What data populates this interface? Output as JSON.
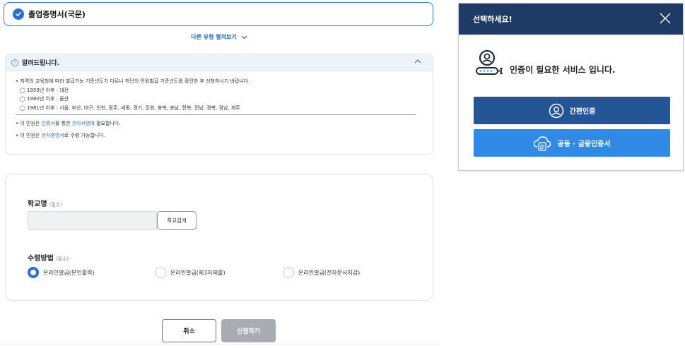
{
  "document": {
    "selected_name": "졸업증명서(국문)",
    "more_types_label": "다른 유형 펼쳐보기"
  },
  "notice": {
    "title": "알려드립니다.",
    "intro": "• 지역의 교육청에 따라 발급가능 기준년도가 다르니 하단의 민원발급 기준년도를 확인한 후 신청하시기 바랍니다.",
    "years": [
      "◯ 1959년 이후 : 대전",
      "◯ 1980년 이후 : 울산",
      "◯ 1981년 이후 : 서울, 부산, 대구, 인천, 광주, 세종, 경기, 강원, 충북, 충남, 전북, 전남, 경북, 경남, 제주"
    ],
    "line2": {
      "pre": "• 이 민원은 ",
      "hl1": "인증서",
      "mid": "를 통한 ",
      "hl2": "전자서명",
      "post": "이 필요합니다."
    },
    "line3": {
      "pre": "• 이 민원은 ",
      "hl": "전자증명서",
      "post": "로 수령 가능합니다."
    }
  },
  "form": {
    "school_label": "학교명",
    "school_required": "(필수)",
    "school_value": "",
    "school_search_button": "학교검색",
    "receive_label": "수령방법",
    "receive_required": "(필수)",
    "receive_options": [
      {
        "label": "온라인발급(본인출력)",
        "selected": true
      },
      {
        "label": "온라인발급(제3자제출)",
        "selected": false
      },
      {
        "label": "온라인발급(전자문서지갑)",
        "selected": false
      }
    ]
  },
  "actions": {
    "cancel": "취소",
    "apply": "신청하기"
  },
  "modal": {
    "title": "선택하세요!",
    "message": "인증이 필요한 서비스 입니다.",
    "simple_auth_button": "간편인증",
    "cert_button": "공동 · 금융인증서"
  },
  "colors": {
    "accent": "#2b6fd6",
    "modal_header": "#1f3a64",
    "simple_auth": "#245597",
    "cert": "#3189e6",
    "disabled": "#a9adb3"
  },
  "icons": [
    "check-circle-icon",
    "chevron-down-icon",
    "info-icon",
    "chevron-up-icon",
    "close-icon",
    "user-auth-icon",
    "person-icon",
    "cloud-cert-icon"
  ]
}
